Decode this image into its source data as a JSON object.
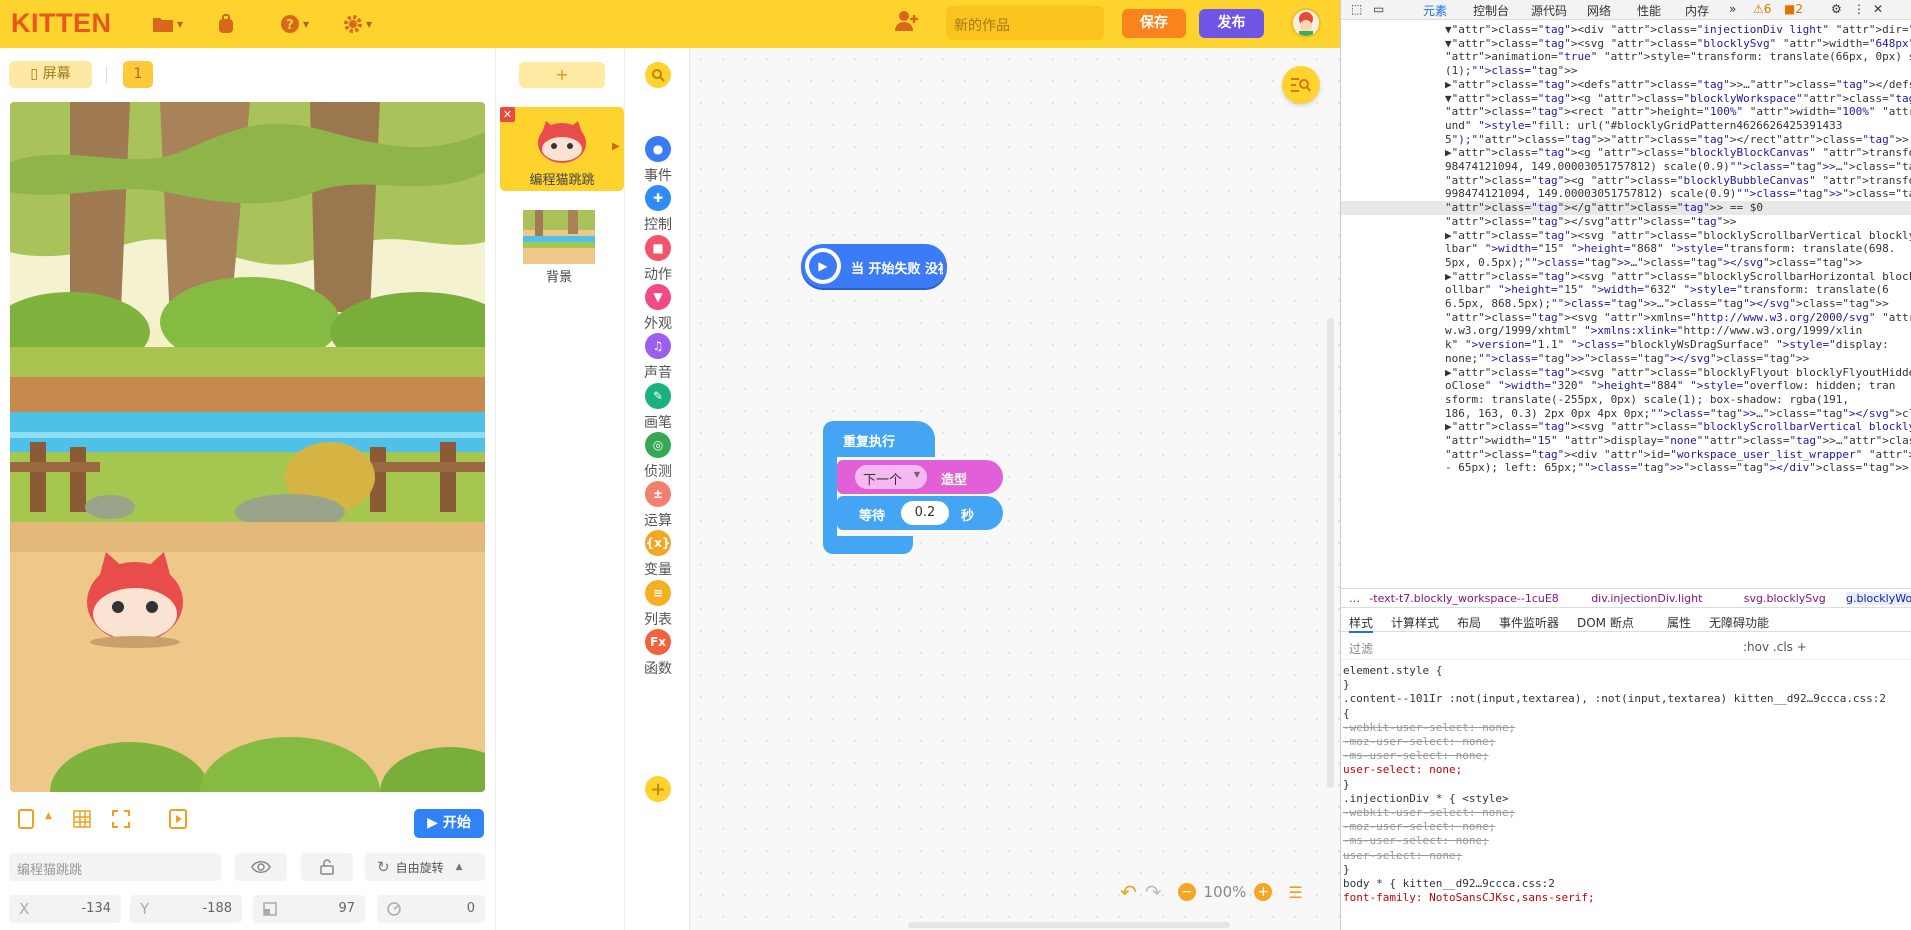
{
  "app": {
    "logo": "KITTEN",
    "project_name_placeholder": "新的作品",
    "save_label": "保存",
    "publish_label": "发布"
  },
  "stage": {
    "screen_label": "屏幕",
    "scene_number": "1",
    "start_label": "开始",
    "sprite_name": "编程猫跳跳",
    "rotation_label": "自由旋转",
    "x_label": "X",
    "x_value": "-134",
    "y_label": "Y",
    "y_value": "-188",
    "size_value": "97",
    "direction_value": "0"
  },
  "sprites": {
    "add_label": "+",
    "items": [
      {
        "name": "编程猫跳跳"
      }
    ],
    "background_label": "背景"
  },
  "categories": [
    {
      "name": "事件",
      "color": "#3c7bf6",
      "icon": "toggle-icon"
    },
    {
      "name": "控制",
      "color": "#2f8cf5",
      "icon": "gamepad-icon"
    },
    {
      "name": "动作",
      "color": "#f2546c",
      "icon": "car-icon"
    },
    {
      "name": "外观",
      "color": "#f34a86",
      "icon": "shirt-icon"
    },
    {
      "name": "声音",
      "color": "#9c5ef0",
      "icon": "music-icon"
    },
    {
      "name": "画笔",
      "color": "#18b37b",
      "icon": "pen-icon"
    },
    {
      "name": "侦测",
      "color": "#34a853",
      "icon": "target-icon"
    },
    {
      "name": "运算",
      "color": "#f57f6e",
      "icon": "calc-icon"
    },
    {
      "name": "变量",
      "color": "#f5a623",
      "icon": "variable-icon"
    },
    {
      "name": "列表",
      "color": "#f5b023",
      "icon": "list-icon"
    },
    {
      "name": "函数",
      "color": "#f4623d",
      "icon": "function-icon"
    }
  ],
  "blocks": {
    "hat": "当 开始失败 没被点",
    "repeat": "重复执行",
    "next_dropdown": "下一个",
    "costume": "造型",
    "wait": "等待",
    "wait_value": "0.2",
    "seconds": "秒"
  },
  "workspace": {
    "zoom": "100%"
  },
  "devtools": {
    "tabs": [
      "元素",
      "控制台",
      "源代码",
      "网络",
      "性能",
      "内存"
    ],
    "warn_count": "6",
    "issue_count": "2",
    "dom_lines": [
      "▼<div class=\"injectionDiv light\" dir=\"LTR\">",
      "  ▼<svg class=\"blocklySvg\" width=\"648px\" height=\"884px\" enable-",
      "   animation=\"true\" style=\"transform: translate(66px, 0px) scale",
      "   (1);\">",
      "    ▶<defs>…</defs>",
      "    ▼<g class=\"blocklyWorkspace\">",
      "       <rect height=\"100%\" width=\"100%\" class=\"blocklyMainBackgro",
      "       und\" style=\"fill: url(\"#blocklyGridPattern4626626425391433",
      "       5\");\"></rect>",
      "      ▶<g class=\"blocklyBlockCanvas\" transform=\"translate(112.999",
      "       98474121094, 149.00003051757812) scale(0.9)\">…</g>",
      "       <g class=\"blocklyBubbleCanvas\" transform=\"translate(112.999",
      "       998474121094, 149.00003051757812) scale(0.9)\"></g>",
      "     </g> == $0",
      "   </svg>",
      "  ▶<svg class=\"blocklyScrollbarVertical blocklyMainWorkspaceScrol",
      "   lbar\" width=\"15\" height=\"868\" style=\"transform: translate(698.",
      "   5px, 0.5px);\">…</svg>",
      "  ▶<svg class=\"blocklyScrollbarHorizontal blocklyMainWorkspaceScr",
      "   ollbar\" height=\"15\" width=\"632\" style=\"transform: translate(6",
      "   6.5px, 868.5px);\">…</svg>",
      "   <svg xmlns=\"http://www.w3.org/2000/svg\" xmlns:html=\"http://ww",
      "   w.w3.org/1999/xhtml\" xmlns:xlink=\"http://www.w3.org/1999/xlin",
      "   k\" version=\"1.1\" class=\"blocklyWsDragSurface\" style=\"display:",
      "   none;\"></svg>",
      "  ▶<svg class=\"blocklyFlyout blocklyFlyoutHidden blocklyFlyoutAut",
      "   oClose\" width=\"320\" height=\"884\" style=\"overflow: hidden; tran",
      "   sform: translate(-255px, 0px) scale(1); box-shadow: rgba(191,",
      "   186, 163, 0.3) 2px 0px 4px 0px;\">…</svg>",
      "  ▶<svg class=\"blocklyScrollbarVertical blocklyFlyoutScrollbar\"",
      "   width=\"15\" display=\"none\">…</svg>",
      "   <div id=\"workspace_user_list_wrapper\" style=\"width: calc(100%",
      "   - 65px); left: 65px;\"></div>  flex"
    ],
    "breadcrumbs": [
      "…",
      "-text-t7.blockly_workspace--1cuE8",
      "div.injectionDiv.light",
      "svg.blocklySvg",
      "g.blocklyWorkspace",
      "…"
    ],
    "style_tabs": [
      "样式",
      "计算样式",
      "布局",
      "事件监听器",
      "DOM 断点",
      "属性",
      "无障碍功能"
    ],
    "filter_placeholder": "过滤",
    "filter_tools": ":hov  .cls  +",
    "rules": [
      "element.style {",
      "}",
      ".content--101Ir :not(input,textarea), :not(input,textarea)   kitten__d92…9ccca.css:2",
      "{",
      "  -webkit-user-select: none;",
      "  -moz-user-select: none;",
      "  -ms-user-select: none;",
      "  user-select: none;",
      "}",
      ".injectionDiv * {                                              <style>",
      "  -webkit-user-select: none;",
      "  -moz-user-select: none;",
      "  -ms-user-select: none;",
      "  user-select: none;",
      "}",
      "body * {                                           kitten__d92…9ccca.css:2",
      "  font-family: NotoSansCJKsc,sans-serif;"
    ]
  }
}
